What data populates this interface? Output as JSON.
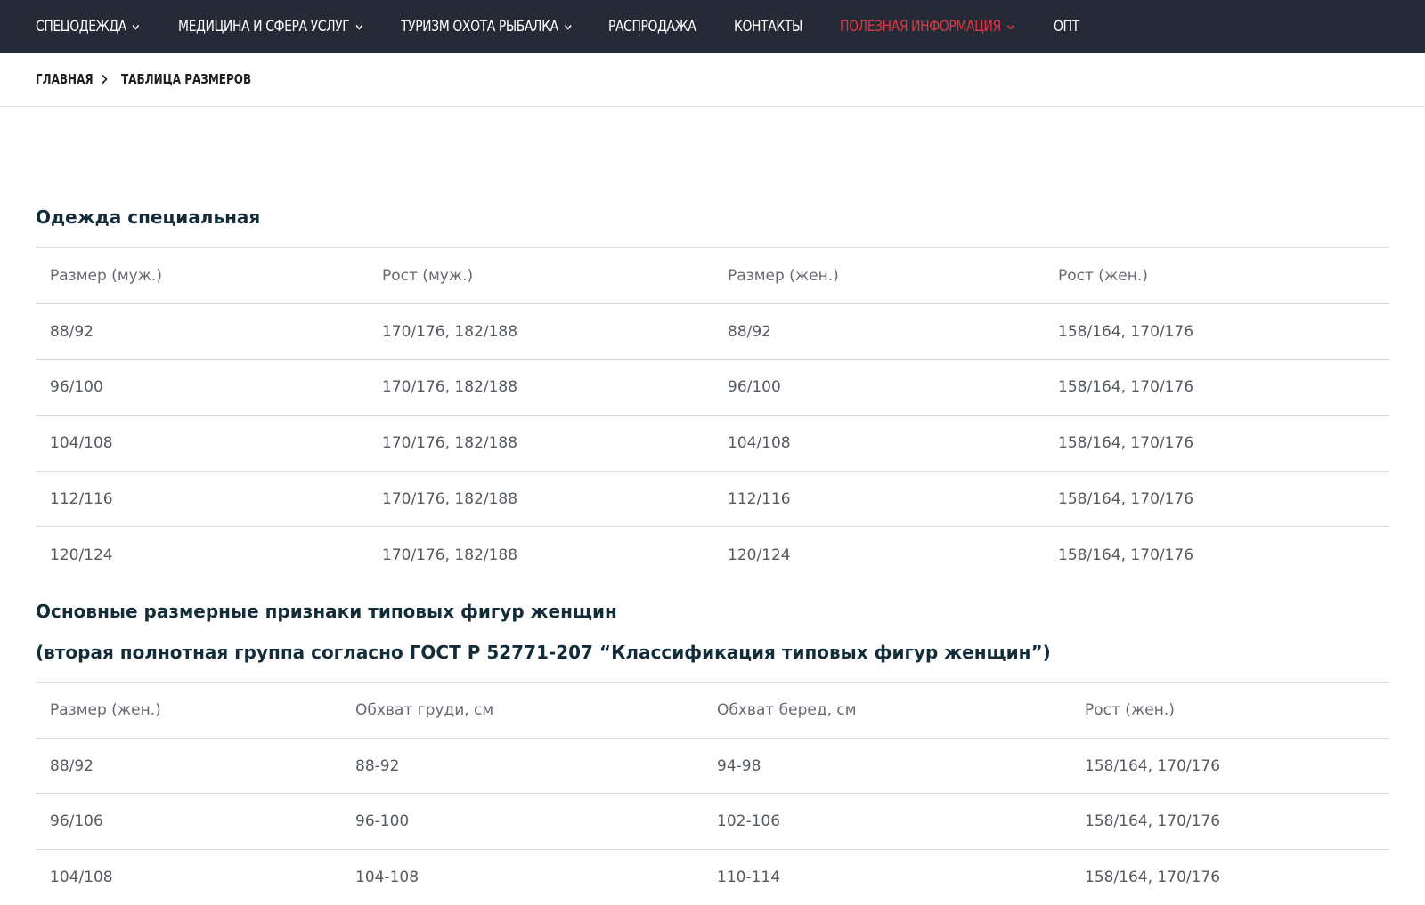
{
  "nav": {
    "items": [
      {
        "label": "СПЕЦОДЕЖДА",
        "dropdown": true
      },
      {
        "label": "МЕДИЦИНА И СФЕРА УСЛУГ",
        "dropdown": true
      },
      {
        "label": "ТУРИЗМ ОХОТА РЫБАЛКА",
        "dropdown": true
      },
      {
        "label": "РАСПРОДАЖА",
        "dropdown": false
      },
      {
        "label": "КОНТАКТЫ",
        "dropdown": false
      },
      {
        "label": "ПОЛЕЗНАЯ ИНФОРМАЦИЯ",
        "dropdown": true,
        "active": true
      },
      {
        "label": "ОПТ",
        "dropdown": false
      }
    ],
    "background": "#262a36",
    "active_color": "#e2353f"
  },
  "breadcrumb": {
    "home": "ГЛАВНАЯ",
    "current": "ТАБЛИЦА РАЗМЕРОВ"
  },
  "section1": {
    "title": "Одежда специальная",
    "headers": [
      "Размер (муж.)",
      "Рост (муж.)",
      "Размер (жен.)",
      "Рост (жен.)"
    ],
    "rows": [
      [
        "88/92",
        "170/176, 182/188",
        "88/92",
        "158/164, 170/176"
      ],
      [
        "96/100",
        "170/176, 182/188",
        "96/100",
        "158/164, 170/176"
      ],
      [
        "104/108",
        "170/176, 182/188",
        "104/108",
        "158/164, 170/176"
      ],
      [
        "112/116",
        "170/176, 182/188",
        "112/116",
        "158/164, 170/176"
      ],
      [
        "120/124",
        "170/176, 182/188",
        "120/124",
        "158/164, 170/176"
      ]
    ]
  },
  "section2": {
    "title": "Основные размерные признаки типовых фигур женщин",
    "subtitle": "(вторая полнотная группа согласно ГОСТ Р 52771-207 “Классификация типовых фигур женщин”)",
    "headers": [
      "Размер (жен.)",
      "Обхват груди, см",
      "Обхват беред, см",
      "Рост (жен.)"
    ],
    "rows": [
      [
        "88/92",
        "88-92",
        "94-98",
        "158/164, 170/176"
      ],
      [
        "96/106",
        "96-100",
        "102-106",
        "158/164, 170/176"
      ],
      [
        "104/108",
        "104-108",
        "110-114",
        "158/164, 170/176"
      ]
    ]
  },
  "icons": {
    "dropdown": "chevron-down-icon",
    "breadcrumb_separator": "chevron-right-icon"
  }
}
